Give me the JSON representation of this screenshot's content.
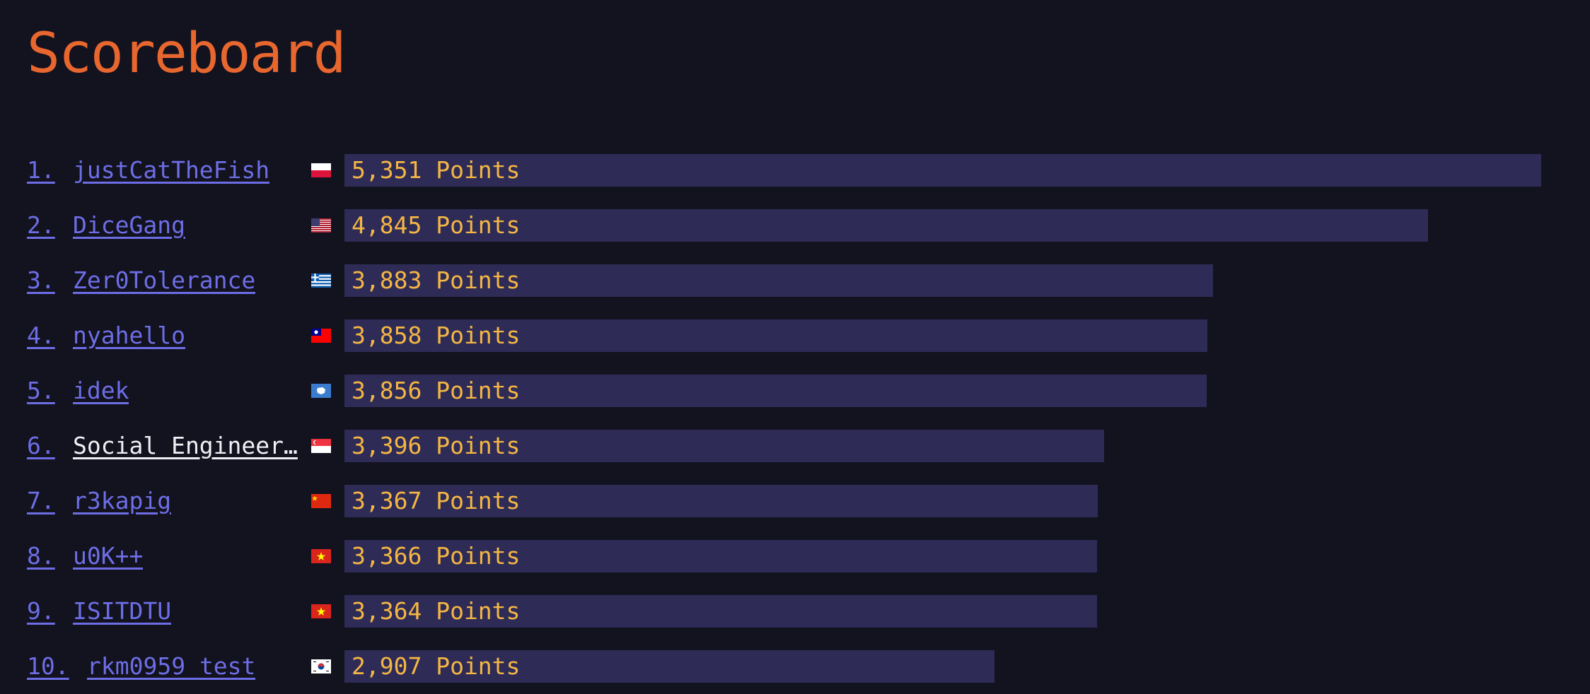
{
  "page": {
    "title": "Scoreboard"
  },
  "colors": {
    "background": "#13121f",
    "title": "#e8672f",
    "link": "#6d6ee6",
    "current_team": "#f0f0f4",
    "bar": "#2e2c57",
    "points": "#f5b643"
  },
  "scoreboard": {
    "max_points": 5351,
    "rows": [
      {
        "rank": "1.",
        "team": "justCatTheFish",
        "flag": "flag-poland-icon",
        "points": 5351,
        "points_label": "5,351 Points",
        "self": false
      },
      {
        "rank": "2.",
        "team": "DiceGang",
        "flag": "flag-usa-icon",
        "points": 4845,
        "points_label": "4,845 Points",
        "self": false
      },
      {
        "rank": "3.",
        "team": "Zer0Tolerance",
        "flag": "flag-greece-icon",
        "points": 3883,
        "points_label": "3,883 Points",
        "self": false
      },
      {
        "rank": "4.",
        "team": "nyahello",
        "flag": "flag-taiwan-icon",
        "points": 3858,
        "points_label": "3,858 Points",
        "self": false
      },
      {
        "rank": "5.",
        "team": "idek",
        "flag": "flag-antarctica-icon",
        "points": 3856,
        "points_label": "3,856 Points",
        "self": false
      },
      {
        "rank": "6.",
        "team": "Social_Engineer…",
        "flag": "flag-singapore-icon",
        "points": 3396,
        "points_label": "3,396 Points",
        "self": true
      },
      {
        "rank": "7.",
        "team": "r3kapig",
        "flag": "flag-china-icon",
        "points": 3367,
        "points_label": "3,367 Points",
        "self": false
      },
      {
        "rank": "8.",
        "team": "u0K++",
        "flag": "flag-vietnam-icon",
        "points": 3366,
        "points_label": "3,366 Points",
        "self": false
      },
      {
        "rank": "9.",
        "team": "ISITDTU",
        "flag": "flag-vietnam-icon",
        "points": 3364,
        "points_label": "3,364 Points",
        "self": false
      },
      {
        "rank": "10.",
        "team": "rkm0959_test",
        "flag": "flag-south-korea-icon",
        "points": 2907,
        "points_label": "2,907 Points",
        "self": false
      }
    ]
  }
}
